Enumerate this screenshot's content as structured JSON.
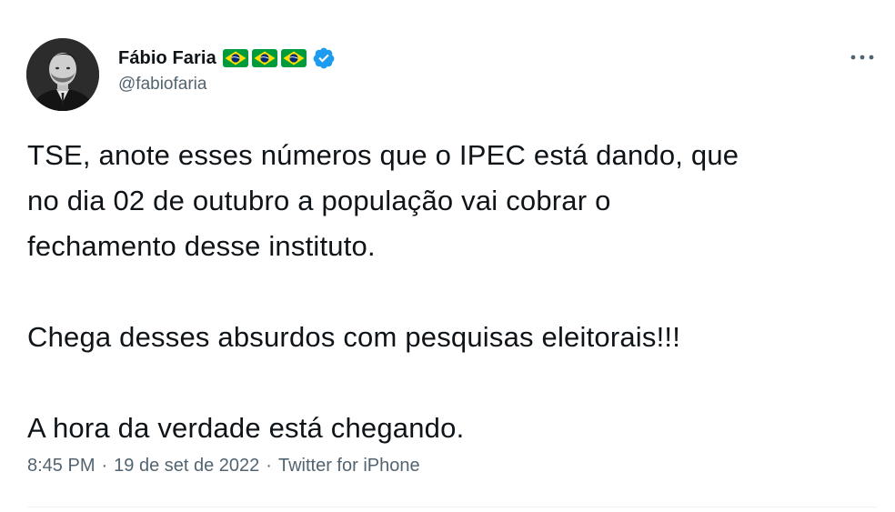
{
  "author": {
    "name": "Fábio Faria",
    "handle": "@fabiofaria",
    "flag_count": 3,
    "verified": true
  },
  "tweet": {
    "paragraphs": [
      [
        "TSE, anote esses números que o IPEC está dando, que",
        "no dia 02 de outubro a população vai cobrar o",
        "fechamento desse instituto."
      ],
      [
        "Chega desses absurdos com pesquisas eleitorais!!!"
      ],
      [
        "A hora da verdade está chegando."
      ]
    ],
    "time": "8:45 PM",
    "separator": "·",
    "date": "19 de set de 2022",
    "source": "Twitter for iPhone"
  },
  "colors": {
    "text": "#0f1419",
    "muted": "#536471",
    "verified_blue": "#1d9bf0",
    "flag_green": "#009b3a",
    "flag_yellow": "#fedf00",
    "flag_blue": "#002776",
    "divider": "#eff3f4"
  },
  "icons": {
    "avatar": "profile-photo",
    "flag": "brazil-flag-icon",
    "verified": "verified-badge-icon",
    "more": "more-horizontal-icon"
  }
}
